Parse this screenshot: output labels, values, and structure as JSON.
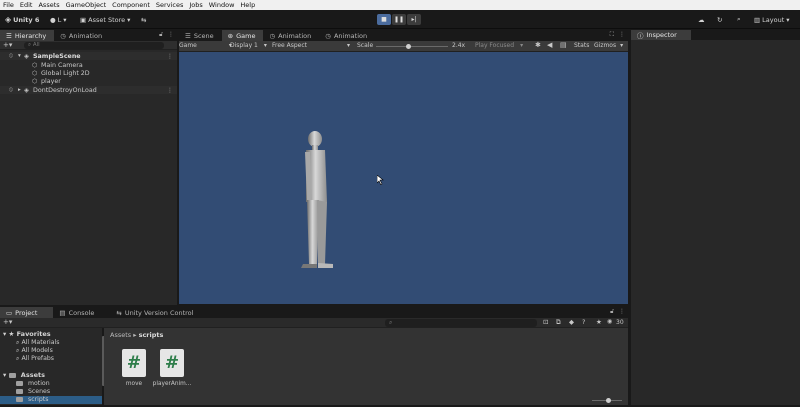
{
  "menu": [
    "File",
    "Edit",
    "Assets",
    "GameObject",
    "Component",
    "Services",
    "Jobs",
    "Window",
    "Help"
  ],
  "toolbar": {
    "app_name": "Unity 6",
    "account": "L",
    "asset_store": "Asset Store",
    "layout": "Layout"
  },
  "hierarchy": {
    "tabs": [
      "Hierarchy",
      "Animation"
    ],
    "search_placeholder": "All",
    "scene": "SampleScene",
    "children": [
      "Main Camera",
      "Global Light 2D",
      "player"
    ],
    "dont_destroy": "DontDestroyOnLoad"
  },
  "center": {
    "tabs": [
      "Scene",
      "Game",
      "Animation",
      "Animation"
    ],
    "game_toolbar": {
      "mode": "Game",
      "display": "Display 1",
      "aspect": "Free Aspect",
      "scale_label": "Scale",
      "scale_value": 0.45,
      "scale_readout": "2.4x",
      "play_focused": "Play Focused",
      "stats": "Stats",
      "gizmos": "Gizmos"
    },
    "game_bg_color": "#324c74"
  },
  "inspector": {
    "tab": "Inspector"
  },
  "bottom": {
    "tabs": [
      "Project",
      "Console",
      "Unity Version Control"
    ],
    "favorites_title": "Favorites",
    "favorites": [
      "All Materials",
      "All Models",
      "All Prefabs"
    ],
    "assets_title": "Assets",
    "folders": [
      "motion",
      "Scenes",
      "scripts"
    ],
    "breadcrumb_root": "Assets",
    "breadcrumb_current": "scripts",
    "visible_count": "30",
    "files": [
      "move",
      "playerAnim..."
    ],
    "zoom_value": 0.55
  }
}
